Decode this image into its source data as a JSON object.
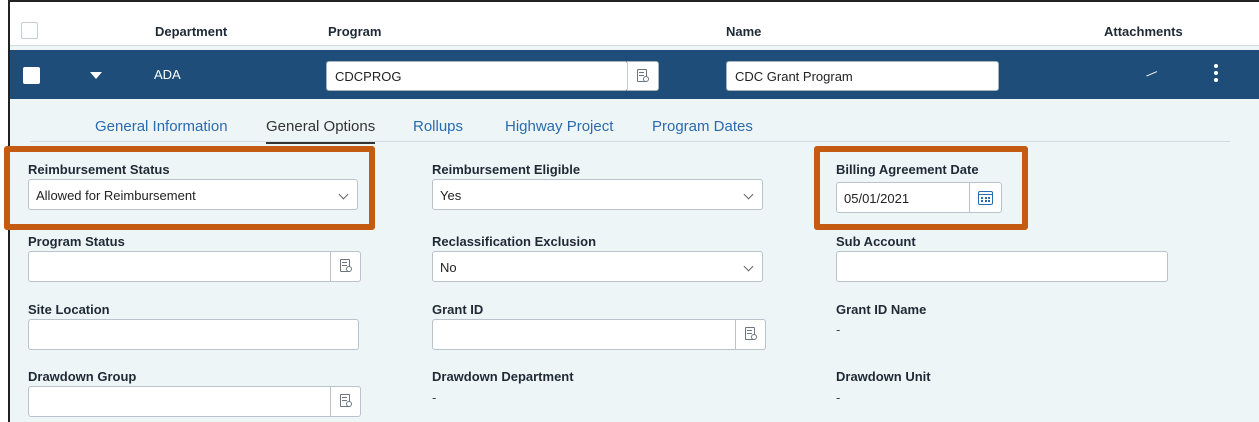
{
  "header": {
    "department": "Department",
    "program": "Program",
    "name": "Name",
    "attachments": "Attachments"
  },
  "row": {
    "department": "ADA",
    "program": "CDCPROG",
    "name": "CDC Grant Program"
  },
  "tabs": [
    {
      "label": "General Information",
      "active": false
    },
    {
      "label": "General Options",
      "active": true
    },
    {
      "label": "Rollups",
      "active": false
    },
    {
      "label": "Highway Project",
      "active": false
    },
    {
      "label": "Program Dates",
      "active": false
    }
  ],
  "fields": {
    "reimbursement_status": {
      "label": "Reimbursement Status",
      "value": "Allowed for Reimbursement"
    },
    "reimbursement_eligible": {
      "label": "Reimbursement Eligible",
      "value": "Yes"
    },
    "billing_agreement_date": {
      "label": "Billing Agreement Date",
      "value": "05/01/2021"
    },
    "program_status": {
      "label": "Program Status",
      "value": ""
    },
    "reclassification_exclusion": {
      "label": "Reclassification Exclusion",
      "value": "No"
    },
    "sub_account": {
      "label": "Sub Account",
      "value": ""
    },
    "site_location": {
      "label": "Site Location",
      "value": ""
    },
    "grant_id": {
      "label": "Grant ID",
      "value": ""
    },
    "grant_id_name": {
      "label": "Grant ID Name",
      "value": "-"
    },
    "drawdown_group": {
      "label": "Drawdown Group",
      "value": ""
    },
    "drawdown_department": {
      "label": "Drawdown Department",
      "value": "-"
    },
    "drawdown_unit": {
      "label": "Drawdown Unit",
      "value": "-"
    }
  },
  "colors": {
    "row_bg": "#1d4d78",
    "tab_link": "#2a6bb0",
    "highlight": "#c55a11",
    "panel_bg": "#eef5f6"
  },
  "icons": {
    "lookup": "lookup-icon",
    "calendar": "calendar-icon",
    "attachment": "paperclip-icon",
    "more": "more-vertical-icon"
  }
}
